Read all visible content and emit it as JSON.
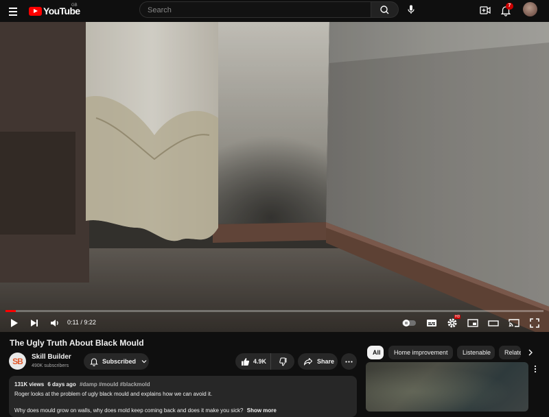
{
  "header": {
    "logo_text": "YouTube",
    "country_code": "GB",
    "search_placeholder": "Search",
    "notification_count": "7",
    "icons": [
      "menu-icon",
      "search-icon",
      "mic-icon",
      "create-icon",
      "bell-icon"
    ]
  },
  "player": {
    "current_time": "0:11",
    "duration": "9:22",
    "time_separator": " / ",
    "progress": 0.0196,
    "quality_badge": "HD",
    "icons": [
      "play-icon",
      "next-icon",
      "volume-icon",
      "autoplay-toggle",
      "subtitles-icon",
      "settings-icon",
      "miniplayer-icon",
      "theater-icon",
      "cast-icon",
      "fullscreen-icon"
    ]
  },
  "video": {
    "title": "The Ugly Truth About Black Mould",
    "channel_name": "Skill Builder",
    "channel_initials": "SB",
    "subscribers": "490K subscribers",
    "subscribe_label": "Subscribed",
    "likes": "4.9K",
    "share_label": "Share"
  },
  "description": {
    "views": "131K views",
    "age": "6 days ago",
    "hashtags": "#damp #mould #blackmold",
    "line1": "Roger looks at the problem of ugly black mould and explains how we can avoid it.",
    "line2": "Why does mould grow on walls, why does mold keep coming back and does it make you sick?",
    "show_more": "Show more"
  },
  "recommendations": {
    "chips": [
      "All",
      "Home improvement",
      "Listenable",
      "Related"
    ],
    "active_chip": "All"
  }
}
